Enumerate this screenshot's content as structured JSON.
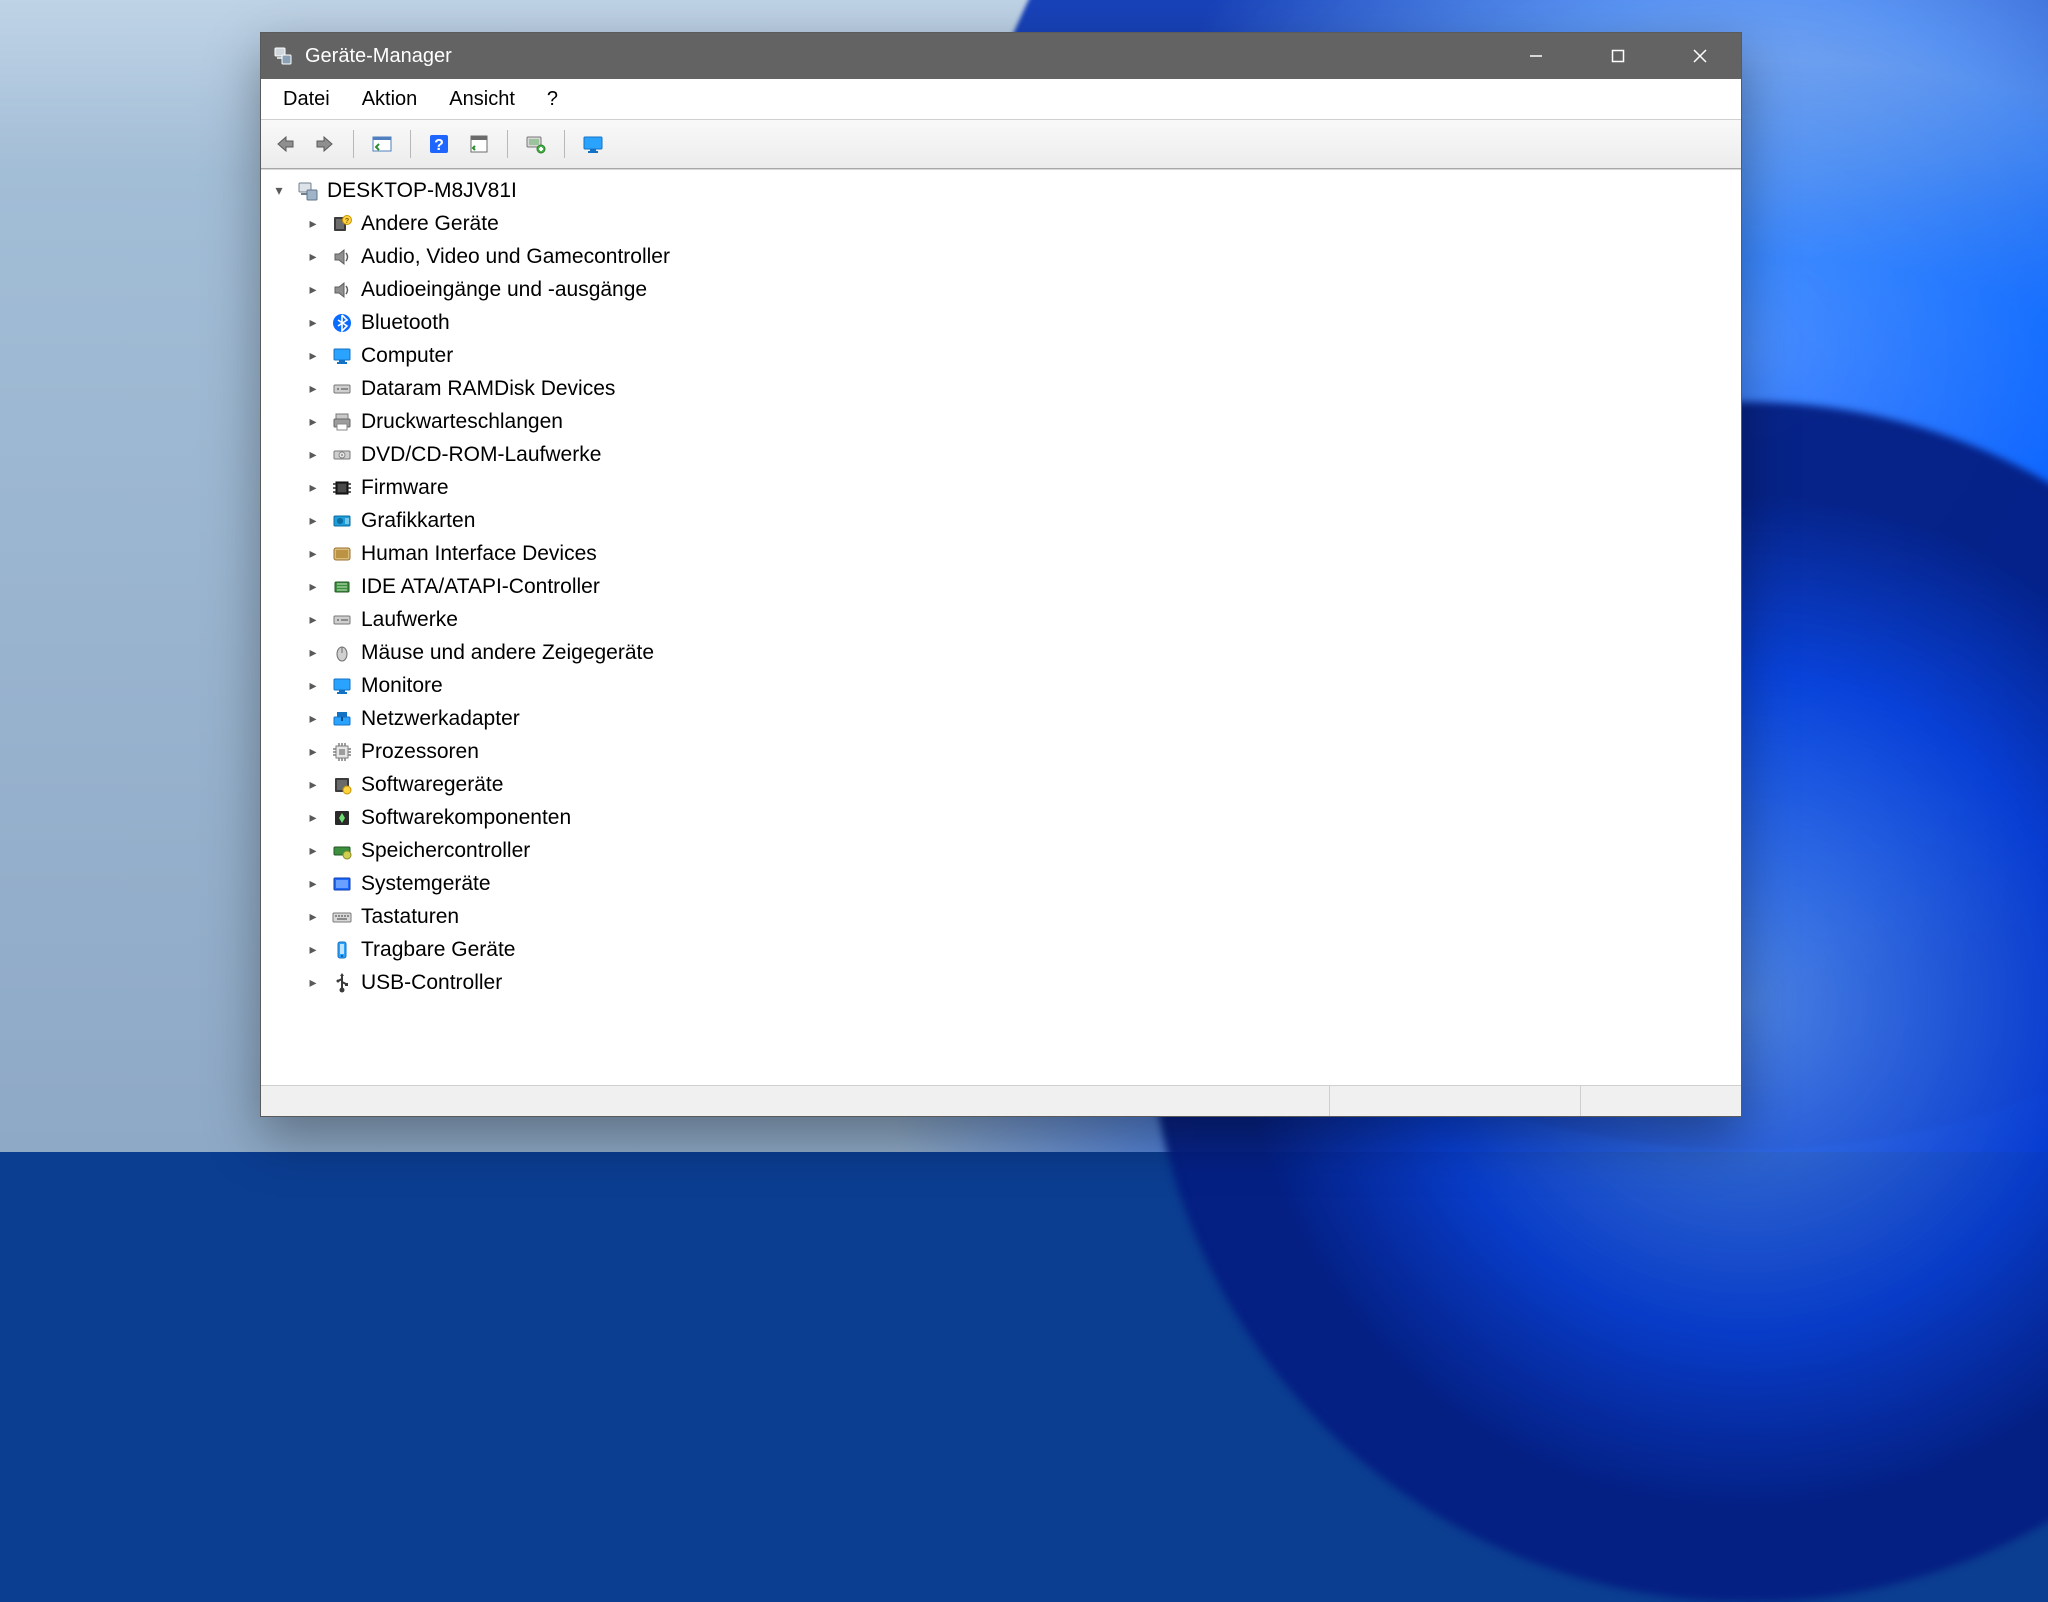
{
  "window": {
    "title": "Geräte-Manager"
  },
  "menubar": {
    "items": [
      {
        "label": "Datei"
      },
      {
        "label": "Aktion"
      },
      {
        "label": "Ansicht"
      },
      {
        "label": "?"
      }
    ]
  },
  "toolbar": {
    "items": [
      {
        "name": "back",
        "icon": "arrow-left-icon"
      },
      {
        "name": "forward",
        "icon": "arrow-right-icon"
      },
      {
        "name": "sep"
      },
      {
        "name": "show-hide",
        "icon": "panel-icon"
      },
      {
        "name": "sep"
      },
      {
        "name": "help",
        "icon": "help-icon"
      },
      {
        "name": "prop-sheet",
        "icon": "sheet-icon"
      },
      {
        "name": "sep"
      },
      {
        "name": "scan",
        "icon": "scan-hw-icon"
      },
      {
        "name": "sep"
      },
      {
        "name": "monitor",
        "icon": "monitor-icon"
      }
    ]
  },
  "tree": {
    "root": {
      "label": "DESKTOP-M8JV81I",
      "expanded": true,
      "icon": "computer-node-icon"
    },
    "categories": [
      {
        "label": "Andere Geräte",
        "icon": "warning-device-icon"
      },
      {
        "label": "Audio, Video und Gamecontroller",
        "icon": "speaker-icon"
      },
      {
        "label": "Audioeingänge und -ausgänge",
        "icon": "speaker-icon"
      },
      {
        "label": "Bluetooth",
        "icon": "bluetooth-icon"
      },
      {
        "label": "Computer",
        "icon": "monitor-blue-icon"
      },
      {
        "label": "Dataram RAMDisk Devices",
        "icon": "drive-icon"
      },
      {
        "label": "Druckwarteschlangen",
        "icon": "printer-icon"
      },
      {
        "label": "DVD/CD-ROM-Laufwerke",
        "icon": "optical-drive-icon"
      },
      {
        "label": "Firmware",
        "icon": "chip-dark-icon"
      },
      {
        "label": "Grafikkarten",
        "icon": "gpu-icon"
      },
      {
        "label": "Human Interface Devices",
        "icon": "hid-icon"
      },
      {
        "label": "IDE ATA/ATAPI-Controller",
        "icon": "ide-icon"
      },
      {
        "label": "Laufwerke",
        "icon": "drive-icon"
      },
      {
        "label": "Mäuse und andere Zeigegeräte",
        "icon": "mouse-icon"
      },
      {
        "label": "Monitore",
        "icon": "monitor-blue-icon"
      },
      {
        "label": "Netzwerkadapter",
        "icon": "network-icon"
      },
      {
        "label": "Prozessoren",
        "icon": "cpu-icon"
      },
      {
        "label": "Softwaregeräte",
        "icon": "software-device-icon"
      },
      {
        "label": "Softwarekomponenten",
        "icon": "component-icon"
      },
      {
        "label": "Speichercontroller",
        "icon": "storage-ctrl-icon"
      },
      {
        "label": "Systemgeräte",
        "icon": "system-device-icon"
      },
      {
        "label": "Tastaturen",
        "icon": "keyboard-icon"
      },
      {
        "label": "Tragbare Geräte",
        "icon": "portable-icon"
      },
      {
        "label": "USB-Controller",
        "icon": "usb-icon"
      }
    ]
  }
}
